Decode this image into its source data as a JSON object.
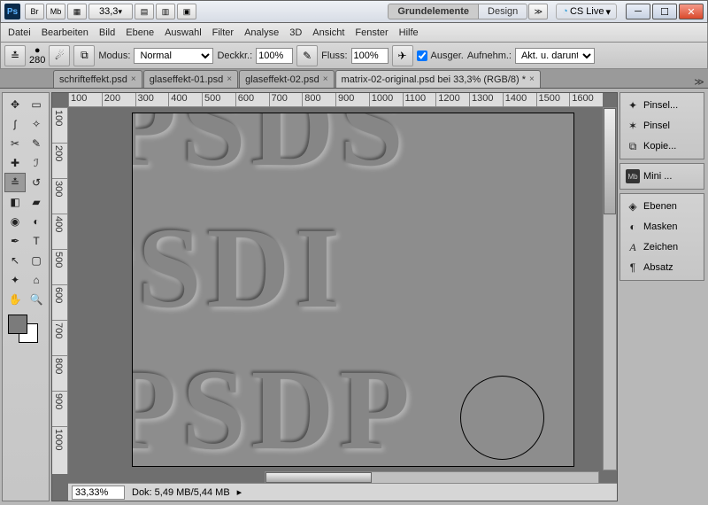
{
  "titlebar": {
    "zoom": "33,3",
    "workspace_active": "Grundelemente",
    "workspace_other": "Design",
    "cslive": "CS Live"
  },
  "menu": {
    "items": [
      "Datei",
      "Bearbeiten",
      "Bild",
      "Ebene",
      "Auswahl",
      "Filter",
      "Analyse",
      "3D",
      "Ansicht",
      "Fenster",
      "Hilfe"
    ]
  },
  "options": {
    "brush_size": "280",
    "modus_label": "Modus:",
    "modus_value": "Normal",
    "deckk_label": "Deckkr.:",
    "deckk_value": "100%",
    "fluss_label": "Fluss:",
    "fluss_value": "100%",
    "ausger_label": "Ausger.",
    "aufnehm_label": "Aufnehm.:",
    "aufnehm_value": "Akt. u. darunter"
  },
  "tabs": {
    "items": [
      {
        "label": "schrifteffekt.psd"
      },
      {
        "label": "glaseffekt-01.psd"
      },
      {
        "label": "glaseffekt-02.psd"
      },
      {
        "label": "matrix-02-original.psd bei 33,3% (RGB/8) *"
      }
    ],
    "active": 3
  },
  "ruler_h": [
    "100",
    "200",
    "300",
    "400",
    "500",
    "600",
    "700",
    "800",
    "900",
    "1000",
    "1100",
    "1200",
    "1300",
    "1400",
    "1500",
    "1600"
  ],
  "ruler_v": [
    "100",
    "200",
    "300",
    "400",
    "500",
    "600",
    "700",
    "800",
    "900",
    "1000"
  ],
  "status": {
    "zoom": "33,33%",
    "dok": "Dok: 5,49 MB/5,44 MB"
  },
  "panels": {
    "group1": [
      {
        "icon": "✦",
        "label": "Pinsel..."
      },
      {
        "icon": "✶",
        "label": "Pinsel"
      },
      {
        "icon": "⧉",
        "label": "Kopie..."
      }
    ],
    "group2": [
      {
        "icon": "Mb",
        "label": "Mini ..."
      }
    ],
    "group3": [
      {
        "icon": "◈",
        "label": "Ebenen"
      },
      {
        "icon": "◐",
        "label": "Masken"
      },
      {
        "icon": "A",
        "label": "Zeichen"
      },
      {
        "icon": "¶",
        "label": "Absatz"
      }
    ]
  },
  "canvas_text": {
    "row1": "PSDS",
    "row2": "PSDI",
    "row3": "PSDP"
  }
}
